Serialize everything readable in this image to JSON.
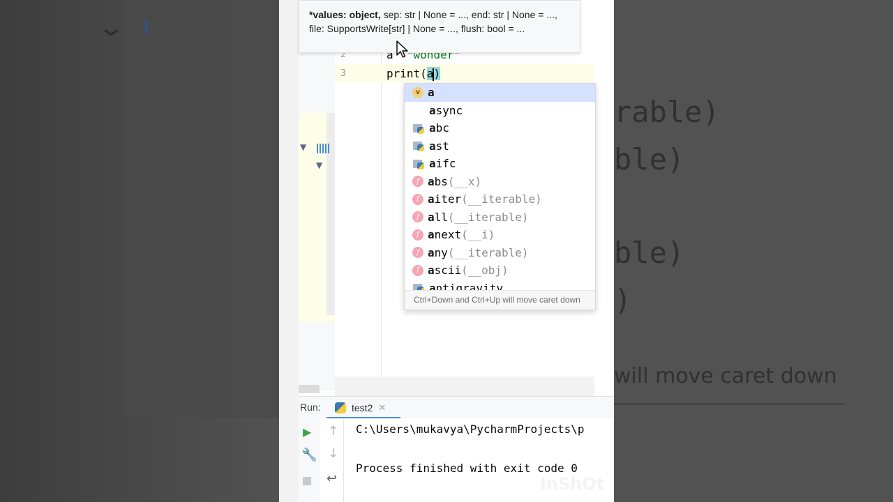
{
  "tooltip": {
    "bold_part": "*values: object,",
    "line1_rest": " sep: str | None = ..., end: str | None = ...,",
    "line2": "file: SupportsWrite[str] | None = ..., flush: bool = ..."
  },
  "editor": {
    "lines": [
      {
        "num": "2",
        "code_prefix": "a",
        "code_string": "\"wonder\""
      },
      {
        "num": "3",
        "code_before": "print(",
        "code_arg": "a",
        "code_after": ")"
      }
    ]
  },
  "completion": {
    "items": [
      {
        "icon": "variable-icon",
        "match": "a",
        "rest": "",
        "sig": ""
      },
      {
        "icon": "keyword",
        "match": "a",
        "rest": "sync",
        "sig": ""
      },
      {
        "icon": "python-module-icon",
        "match": "a",
        "rest": "bc",
        "sig": ""
      },
      {
        "icon": "python-module-icon",
        "match": "a",
        "rest": "st",
        "sig": ""
      },
      {
        "icon": "python-module-icon",
        "match": "a",
        "rest": "ifc",
        "sig": ""
      },
      {
        "icon": "function-icon",
        "match": "a",
        "rest": "bs",
        "sig": "(__x)"
      },
      {
        "icon": "function-icon",
        "match": "a",
        "rest": "iter",
        "sig": "(__iterable)"
      },
      {
        "icon": "function-icon",
        "match": "a",
        "rest": "ll",
        "sig": "(__iterable)"
      },
      {
        "icon": "function-icon",
        "match": "a",
        "rest": "next",
        "sig": "(__i)"
      },
      {
        "icon": "function-icon",
        "match": "a",
        "rest": "ny",
        "sig": "(__iterable)"
      },
      {
        "icon": "function-icon",
        "match": "a",
        "rest": "scii",
        "sig": "(__obj)"
      },
      {
        "icon": "python-module-icon",
        "match": "a",
        "rest": "ntigravity",
        "sig": ""
      }
    ],
    "hint": "Ctrl+Down and Ctrl+Up will move caret down"
  },
  "run": {
    "label": "Run:",
    "tab_name": "test2",
    "console": [
      "C:\\Users\\mukavya\\PycharmProjects\\p",
      "",
      "Process finished with exit code 0"
    ]
  },
  "background_echo": {
    "lines": [
      "rable)",
      "ble)",
      "ble)",
      ")"
    ],
    "hint": "will move caret down"
  },
  "watermark": "InShOt"
}
